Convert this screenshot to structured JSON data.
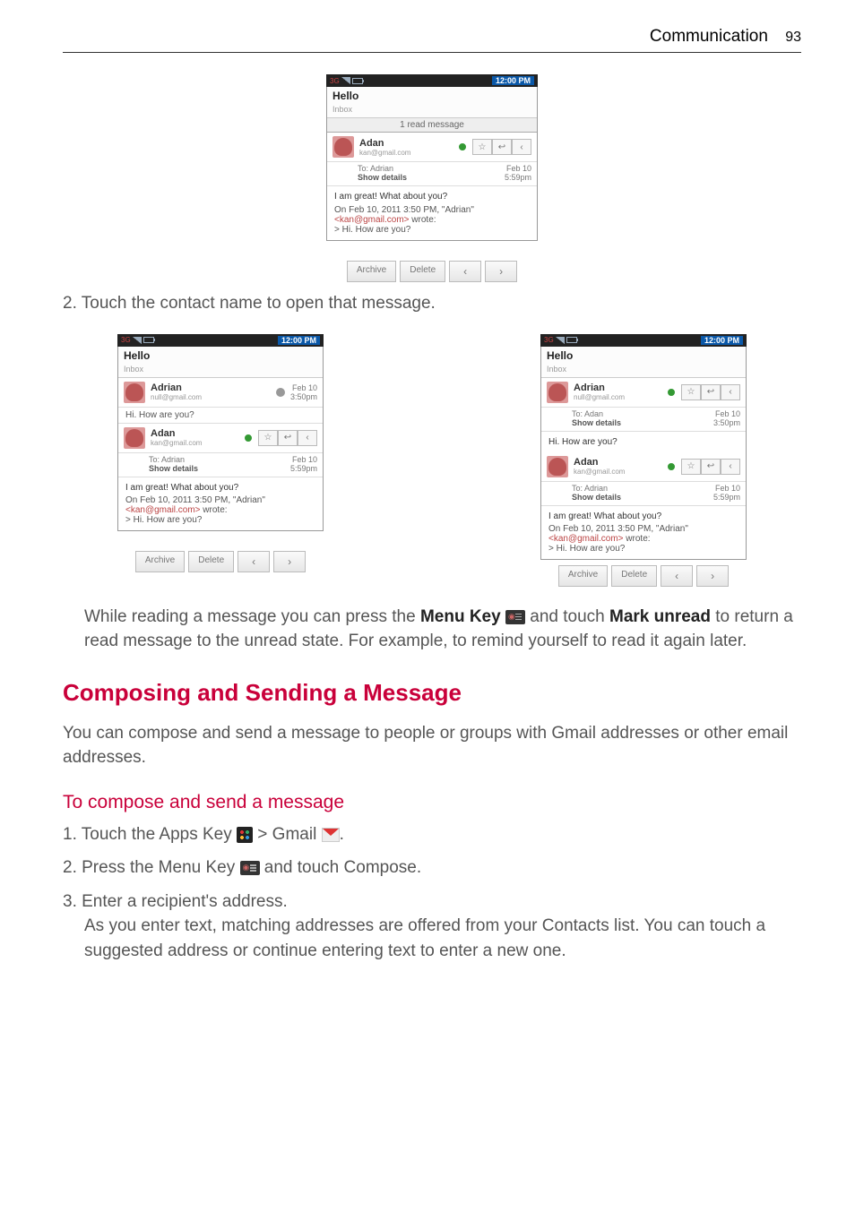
{
  "header": {
    "section": "Communication",
    "page": "93"
  },
  "statusbar": {
    "time": "12:00 PM"
  },
  "email": {
    "subject": "Hello",
    "folder": "Inbox",
    "tab_read": "1 read message",
    "from_name": "Adan",
    "from_email": "kan@gmail.com",
    "to_label": "To:",
    "to_name": "Adrian",
    "show_details": "Show details",
    "date": "Feb 10",
    "time_small": "5:59pm",
    "body_line1": "I am great! What about you?",
    "body_quote": "On Feb 10, 2011 3:50 PM, \"Adrian\"",
    "body_quote_email": "<kan@gmail.com>",
    "body_quote_wrote": " wrote:",
    "body_quote_body": "> Hi. How are you?"
  },
  "thread": {
    "contact1_name": "Adrian",
    "contact1_email": "null@gmail.com",
    "contact1_date": "Feb 10",
    "contact1_time": "3:50pm",
    "hi_line": "Hi. How are you?",
    "contact2_name": "Adan",
    "contact2_email": "kan@gmail.com",
    "contact2_to": "To: Adrian",
    "contact2_date": "Feb 10",
    "contact2_time": "5:59pm"
  },
  "buttons": {
    "archive": "Archive",
    "delete": "Delete",
    "prev": "‹",
    "next": "›",
    "star": "☆",
    "reply": "↩",
    "more": "‹"
  },
  "text": {
    "step2": "2.  Touch the contact name to open that message.",
    "para1_a": "While reading a message you can press the ",
    "para1_menu": "Menu Key",
    "para1_b": " and touch ",
    "para1_mark": "Mark unread",
    "para1_c": " to return a read message to the unread state. For example, to remind yourself to read it again later.",
    "h2": "Composing and Sending a Message",
    "para2": "You can compose and send a message to people or groups with Gmail addresses or other email addresses.",
    "h3": "To compose and send a message",
    "s1a": "1.  Touch the ",
    "s1_apps": "Apps Key",
    "s1b": " > ",
    "s1_gmail": "Gmail",
    "s1c": ".",
    "s2a": "2.  Press the ",
    "s2_menu": "Menu Key",
    "s2b": " and touch ",
    "s2_compose": "Compose",
    "s2c": ".",
    "s3a": "3.  Enter a recipient's address.",
    "s3b": "As you enter text, matching addresses are offered from your Contacts list. You can touch a suggested address or continue entering text to enter a new one."
  }
}
